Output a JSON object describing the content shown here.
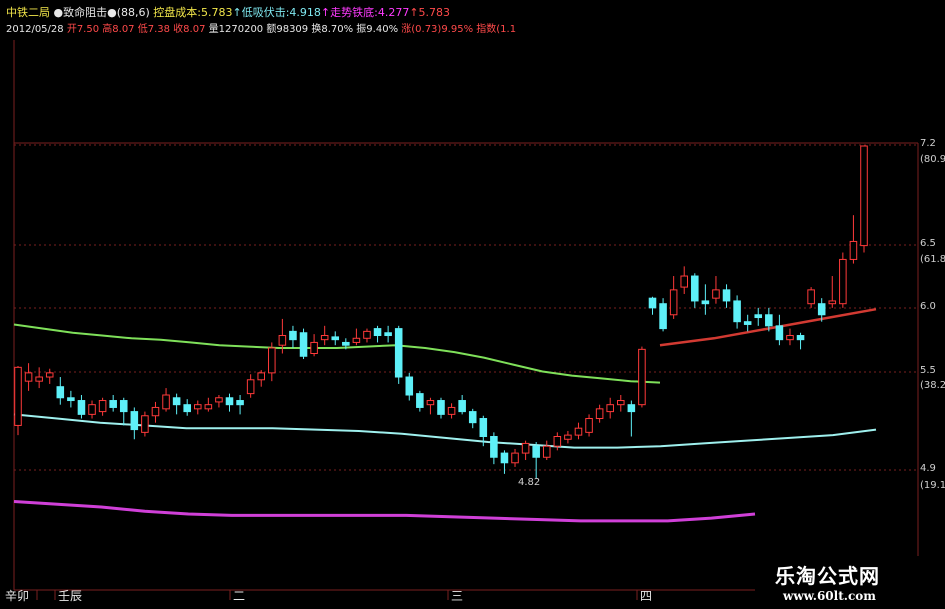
{
  "header": {
    "line1": [
      {
        "text": "中铁二局",
        "color": "#f2e64a"
      },
      {
        "text": " ●致命阻击●",
        "color": "#e8e8e8"
      },
      {
        "text": "(88,6)",
        "color": "#e8e8e8"
      },
      {
        "text": " 控盘成本:5.783",
        "color": "#f2e64a"
      },
      {
        "text": "↑低吸伏击:4.918",
        "color": "#7fe8f0"
      },
      {
        "text": "↑走势铁底:4.277",
        "color": "#ff3bff"
      },
      {
        "text": "↑5.783",
        "color": "#ff4a4a"
      }
    ],
    "line2": [
      {
        "text": "2012/05/28",
        "color": "#e8e8e8"
      },
      {
        "text": " 开7.50",
        "color": "#ff4a4a"
      },
      {
        "text": " 高8.07",
        "color": "#ff4a4a"
      },
      {
        "text": " 低7.38",
        "color": "#ff4a4a"
      },
      {
        "text": " 收8.07",
        "color": "#ff4a4a"
      },
      {
        "text": " 量1270200",
        "color": "#e8e8e8"
      },
      {
        "text": " 额98309",
        "color": "#e8e8e8"
      },
      {
        "text": " 换8.70%",
        "color": "#e8e8e8"
      },
      {
        "text": " 振9.40%",
        "color": "#e8e8e8"
      },
      {
        "text": " 涨(0.73)9.95%",
        "color": "#ff4a4a"
      },
      {
        "text": " 指数(1.1",
        "color": "#ff4a4a"
      }
    ]
  },
  "chart_data": {
    "type": "candlestick",
    "price_labels": [
      "7.2",
      "(80.9",
      "6.5",
      "(61.8",
      "6.0",
      "5.5",
      "(38.2",
      "4.9",
      "(19.1"
    ],
    "low_annotation": "4.82",
    "period_labels": [
      "辛卯",
      "壬辰",
      "二",
      "三",
      "四"
    ],
    "ylim": [
      4.5,
      7.3
    ],
    "candles": [
      [
        5.2,
        5.62,
        5.13,
        5.63
      ],
      [
        5.52,
        5.58,
        5.45,
        5.65
      ],
      [
        5.52,
        5.55,
        5.47,
        5.62
      ],
      [
        5.55,
        5.58,
        5.5,
        5.61
      ],
      [
        5.48,
        5.4,
        5.35,
        5.55
      ],
      [
        5.4,
        5.38,
        5.33,
        5.45
      ],
      [
        5.38,
        5.28,
        5.25,
        5.42
      ],
      [
        5.28,
        5.35,
        5.25,
        5.38
      ],
      [
        5.3,
        5.38,
        5.27,
        5.4
      ],
      [
        5.38,
        5.33,
        5.3,
        5.42
      ],
      [
        5.38,
        5.3,
        5.2,
        5.4
      ],
      [
        5.3,
        5.17,
        5.1,
        5.33
      ],
      [
        5.15,
        5.27,
        5.12,
        5.3
      ],
      [
        5.27,
        5.33,
        5.22,
        5.37
      ],
      [
        5.32,
        5.42,
        5.3,
        5.47
      ],
      [
        5.4,
        5.35,
        5.28,
        5.43
      ],
      [
        5.35,
        5.3,
        5.27,
        5.39
      ],
      [
        5.32,
        5.35,
        5.28,
        5.38
      ],
      [
        5.32,
        5.35,
        5.3,
        5.4
      ],
      [
        5.37,
        5.4,
        5.33,
        5.42
      ],
      [
        5.4,
        5.35,
        5.3,
        5.43
      ],
      [
        5.38,
        5.35,
        5.28,
        5.42
      ],
      [
        5.43,
        5.53,
        5.4,
        5.57
      ],
      [
        5.53,
        5.58,
        5.48,
        5.6
      ],
      [
        5.58,
        5.76,
        5.52,
        5.8
      ],
      [
        5.78,
        5.85,
        5.72,
        5.97
      ],
      [
        5.88,
        5.82,
        5.76,
        5.92
      ],
      [
        5.87,
        5.7,
        5.68,
        5.9
      ],
      [
        5.72,
        5.8,
        5.7,
        5.86
      ],
      [
        5.82,
        5.85,
        5.78,
        5.92
      ],
      [
        5.84,
        5.82,
        5.78,
        5.88
      ],
      [
        5.8,
        5.78,
        5.75,
        5.83
      ],
      [
        5.8,
        5.83,
        5.78,
        5.9
      ],
      [
        5.83,
        5.88,
        5.8,
        5.9
      ],
      [
        5.9,
        5.85,
        5.8,
        5.92
      ],
      [
        5.87,
        5.85,
        5.8,
        5.92
      ],
      [
        5.9,
        5.55,
        5.5,
        5.92
      ],
      [
        5.55,
        5.42,
        5.38,
        5.58
      ],
      [
        5.43,
        5.33,
        5.3,
        5.45
      ],
      [
        5.35,
        5.38,
        5.28,
        5.4
      ],
      [
        5.38,
        5.28,
        5.25,
        5.4
      ],
      [
        5.28,
        5.33,
        5.25,
        5.36
      ],
      [
        5.38,
        5.3,
        5.28,
        5.42
      ],
      [
        5.3,
        5.22,
        5.18,
        5.32
      ],
      [
        5.25,
        5.12,
        5.05,
        5.27
      ],
      [
        5.12,
        4.97,
        4.92,
        5.15
      ],
      [
        5.0,
        4.93,
        4.85,
        5.02
      ],
      [
        4.93,
        5.0,
        4.9,
        5.03
      ],
      [
        5.0,
        5.07,
        4.95,
        5.09
      ],
      [
        5.05,
        4.97,
        4.82,
        5.08
      ],
      [
        4.97,
        5.05,
        4.95,
        5.09
      ],
      [
        5.05,
        5.12,
        5.02,
        5.15
      ],
      [
        5.1,
        5.13,
        5.07,
        5.16
      ],
      [
        5.13,
        5.18,
        5.1,
        5.22
      ],
      [
        5.15,
        5.25,
        5.12,
        5.28
      ],
      [
        5.25,
        5.32,
        5.22,
        5.35
      ],
      [
        5.3,
        5.35,
        5.25,
        5.4
      ],
      [
        5.35,
        5.38,
        5.3,
        5.42
      ],
      [
        5.35,
        5.3,
        5.12,
        5.38
      ],
      [
        5.35,
        5.75,
        5.33,
        5.77
      ],
      [
        6.12,
        6.05,
        6.0,
        6.13
      ],
      [
        6.08,
        5.9,
        5.88,
        6.12
      ],
      [
        6.0,
        6.18,
        5.97,
        6.28
      ],
      [
        6.2,
        6.28,
        6.15,
        6.35
      ],
      [
        6.28,
        6.1,
        6.05,
        6.3
      ],
      [
        6.1,
        6.08,
        6.0,
        6.22
      ],
      [
        6.12,
        6.18,
        6.08,
        6.28
      ],
      [
        6.18,
        6.1,
        6.05,
        6.22
      ],
      [
        6.1,
        5.95,
        5.9,
        6.14
      ],
      [
        5.95,
        5.93,
        5.88,
        6.0
      ],
      [
        6.0,
        5.98,
        5.92,
        6.05
      ],
      [
        6.0,
        5.92,
        5.88,
        6.05
      ],
      [
        5.92,
        5.82,
        5.78,
        6.0
      ],
      [
        5.82,
        5.85,
        5.78,
        5.9
      ],
      [
        5.85,
        5.82,
        5.75,
        5.87
      ],
      [
        6.08,
        6.18,
        6.05,
        6.2
      ],
      [
        6.08,
        6.0,
        5.95,
        6.12
      ],
      [
        6.08,
        6.1,
        6.05,
        6.28
      ],
      [
        6.08,
        6.4,
        6.05,
        6.45
      ],
      [
        6.4,
        6.53,
        6.37,
        6.72
      ],
      [
        6.5,
        7.22,
        6.45,
        7.22
      ]
    ],
    "ma_green": [
      5.93,
      5.9,
      5.87,
      5.85,
      5.83,
      5.82,
      5.8,
      5.78,
      5.77,
      5.76,
      5.76,
      5.76,
      5.77,
      5.78,
      5.76,
      5.73,
      5.69,
      5.64,
      5.59,
      5.56,
      5.54,
      5.52,
      5.51
    ],
    "ma_red": [
      5.78,
      5.83,
      5.9,
      5.97,
      6.04
    ],
    "ma_cyan": [
      5.28,
      5.25,
      5.22,
      5.2,
      5.18,
      5.18,
      5.18,
      5.17,
      5.16,
      5.14,
      5.11,
      5.08,
      5.06,
      5.04,
      5.04,
      5.05,
      5.07,
      5.09,
      5.11,
      5.13,
      5.17
    ],
    "ma_magenta": [
      4.65,
      4.63,
      4.61,
      4.58,
      4.56,
      4.55,
      4.55,
      4.55,
      4.55,
      4.55,
      4.54,
      4.53,
      4.52,
      4.51,
      4.51,
      4.51,
      4.53,
      4.56
    ],
    "colors": {
      "up": "#ff3a3a",
      "down": "#5ef0f8",
      "green_ma": "#7fe05a",
      "red_ma": "#d23a32",
      "cyan_ma": "#9ff0ee",
      "magenta_ma": "#d040d8",
      "grid": "#7a2020"
    }
  },
  "watermark": {
    "title": "乐淘公式网",
    "url": "www.60lt.com"
  }
}
